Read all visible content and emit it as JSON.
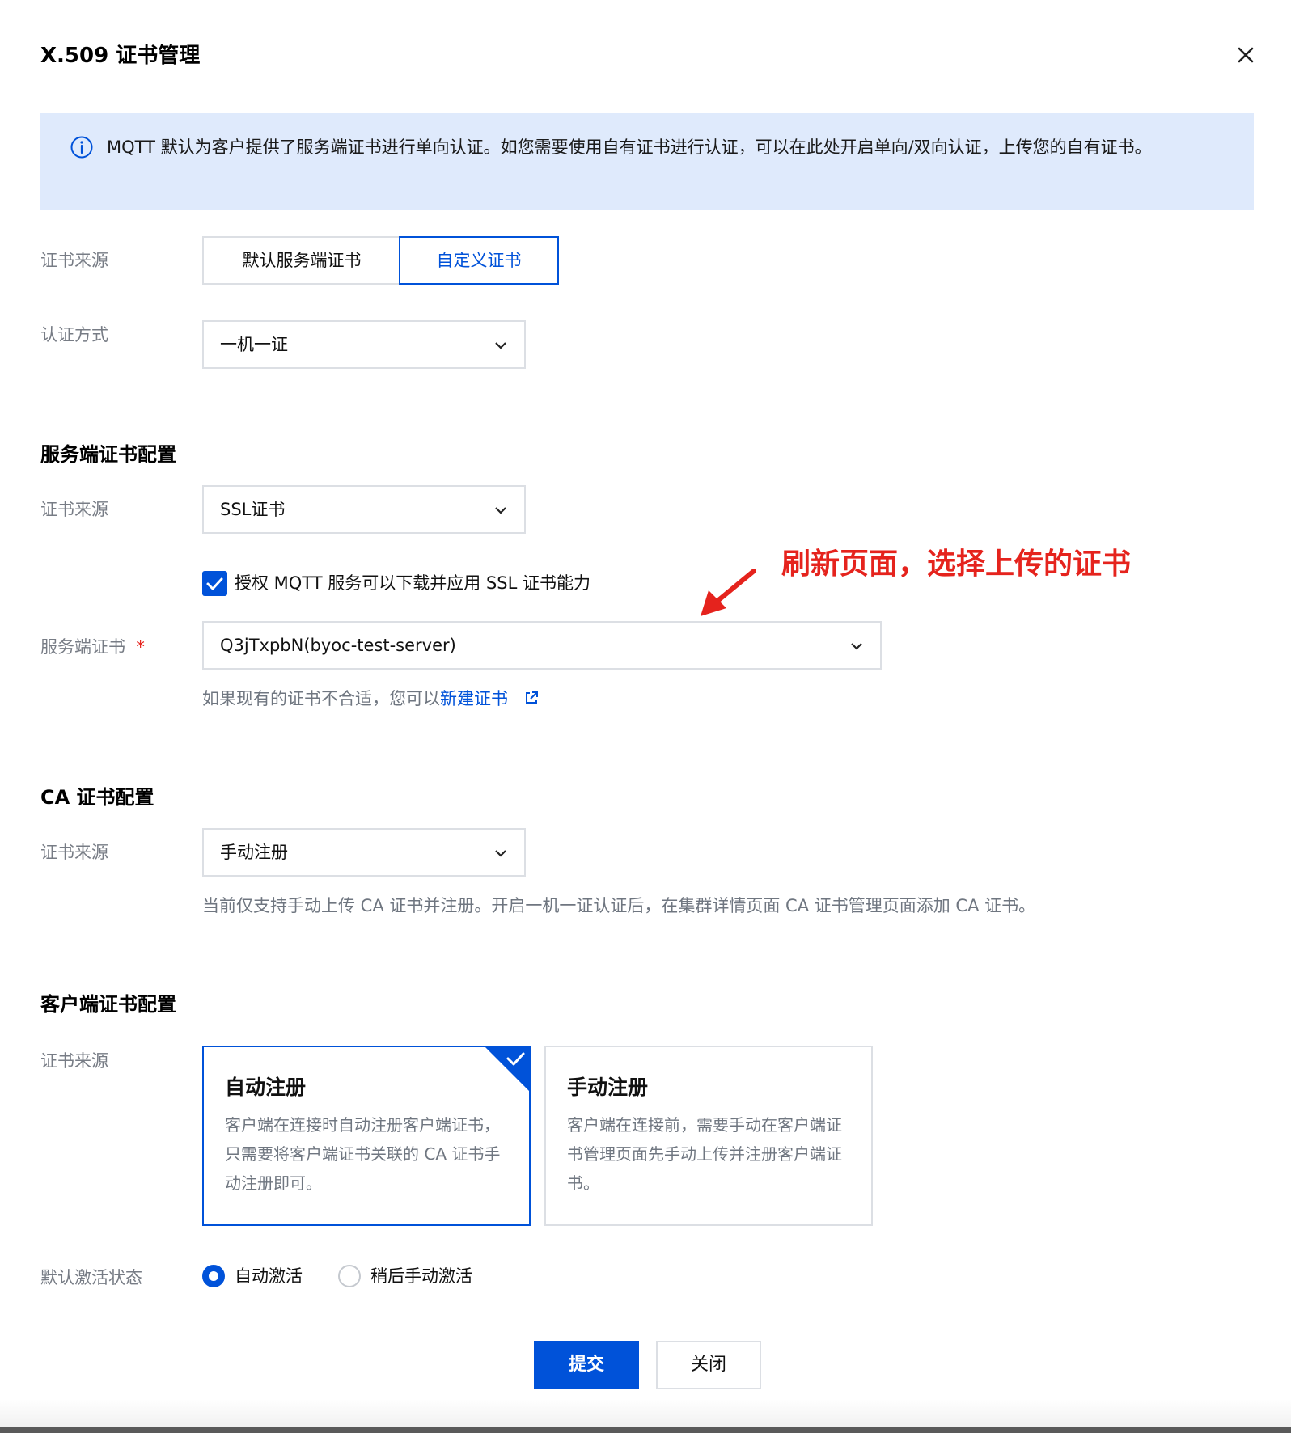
{
  "dialog": {
    "title": "X.509 证书管理",
    "notice": "MQTT 默认为客户提供了服务端证书进行单向认证。如您需要使用自有证书进行认证，可以在此处开启单向/双向认证，上传您的自有证书。"
  },
  "cert_source": {
    "label": "证书来源",
    "options": [
      "默认服务端证书",
      "自定义证书"
    ],
    "selected": "自定义证书"
  },
  "auth_method": {
    "label": "认证方式",
    "value": "一机一证"
  },
  "server_section": {
    "title": "服务端证书配置",
    "source_label": "证书来源",
    "source_value": "SSL证书",
    "authorize_checked": true,
    "authorize_label": "授权 MQTT 服务可以下载并应用 SSL 证书能力",
    "cert_label": "服务端证书",
    "required_mark": "*",
    "cert_value": "Q3jTxpbN(byoc-test-server)",
    "hint_prefix": "如果现有的证书不合适，您可以",
    "hint_link": "新建证书"
  },
  "annotation": {
    "text": "刷新页面，选择上传的证书",
    "color": "#e5231d"
  },
  "ca_section": {
    "title": "CA 证书配置",
    "source_label": "证书来源",
    "source_value": "手动注册",
    "hint": "当前仅支持手动上传 CA 证书并注册。开启一机一证认证后，在集群详情页面 CA 证书管理页面添加 CA 证书。"
  },
  "client_section": {
    "title": "客户端证书配置",
    "source_label": "证书来源",
    "cards": [
      {
        "title": "自动注册",
        "desc": "客户端在连接时自动注册客户端证书，只需要将客户端证书关联的 CA 证书手动注册即可。",
        "selected": true
      },
      {
        "title": "手动注册",
        "desc": "客户端在连接前，需要手动在客户端证书管理页面先手动上传并注册客户端证书。",
        "selected": false
      }
    ],
    "activation_label": "默认激活状态",
    "activation_options": [
      "自动激活",
      "稍后手动激活"
    ],
    "activation_selected": "自动激活"
  },
  "buttons": {
    "submit": "提交",
    "close": "关闭"
  },
  "colors": {
    "primary": "#0052d9",
    "notice_bg": "#dfeafc",
    "border": "#dcdfe4",
    "label": "#777c85",
    "annotation": "#e5231d"
  }
}
